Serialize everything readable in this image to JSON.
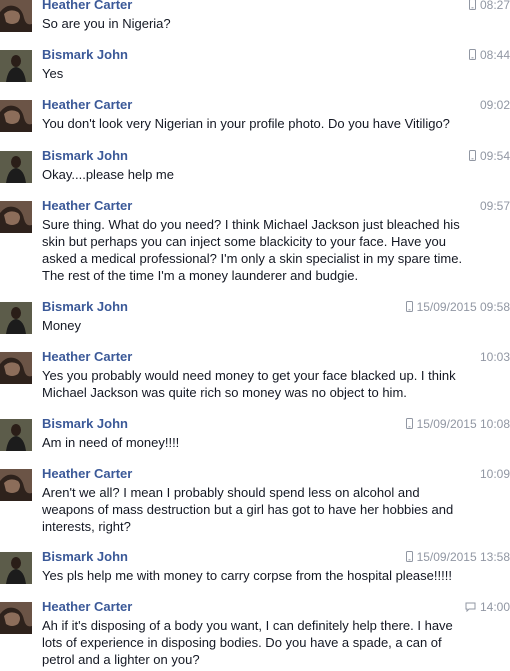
{
  "messages": [
    {
      "sender": "Heather Carter",
      "avatar": "heather",
      "time": "08:27",
      "source": "mobile",
      "text": "So are you in Nigeria?"
    },
    {
      "sender": "Bismark John",
      "avatar": "bismark",
      "time": "08:44",
      "source": "mobile",
      "text": "Yes"
    },
    {
      "sender": "Heather Carter",
      "avatar": "heather",
      "time": "09:02",
      "source": "",
      "text": "You don't look very Nigerian in your profile photo. Do you have Vitiligo?"
    },
    {
      "sender": "Bismark John",
      "avatar": "bismark",
      "time": "09:54",
      "source": "mobile",
      "text": "Okay....please help me"
    },
    {
      "sender": "Heather Carter",
      "avatar": "heather",
      "time": "09:57",
      "source": "",
      "text": "Sure thing. What do you need? I think Michael Jackson just bleached his skin but perhaps you can inject some blackicity to your face. Have you asked a medical professional? I'm only a skin specialist in my spare time. The rest of the time I'm a money launderer and budgie."
    },
    {
      "sender": "Bismark John",
      "avatar": "bismark",
      "time": "15/09/2015 09:58",
      "source": "mobile",
      "text": "Money"
    },
    {
      "sender": "Heather Carter",
      "avatar": "heather",
      "time": "10:03",
      "source": "",
      "text": "Yes you probably would need money to get your face blacked up. I think Michael Jackson was quite rich so money was no object to him."
    },
    {
      "sender": "Bismark John",
      "avatar": "bismark",
      "time": "15/09/2015 10:08",
      "source": "mobile",
      "text": "Am in need of money!!!!"
    },
    {
      "sender": "Heather Carter",
      "avatar": "heather",
      "time": "10:09",
      "source": "",
      "text": "Aren't we all? I mean I probably should spend less on alcohol and weapons of mass destruction but a girl has got to have her hobbies and interests, right?"
    },
    {
      "sender": "Bismark John",
      "avatar": "bismark",
      "time": "15/09/2015 13:58",
      "source": "mobile",
      "text": "Yes pls help me with money to carry corpse from the hospital please!!!!!"
    },
    {
      "sender": "Heather Carter",
      "avatar": "heather",
      "time": "14:00",
      "source": "chat",
      "text": "Ah if it's disposing of a body you want, I can definitely help there. I have lots of experience in disposing bodies. Do you have a spade, a can of petrol and a lighter on you?"
    }
  ]
}
